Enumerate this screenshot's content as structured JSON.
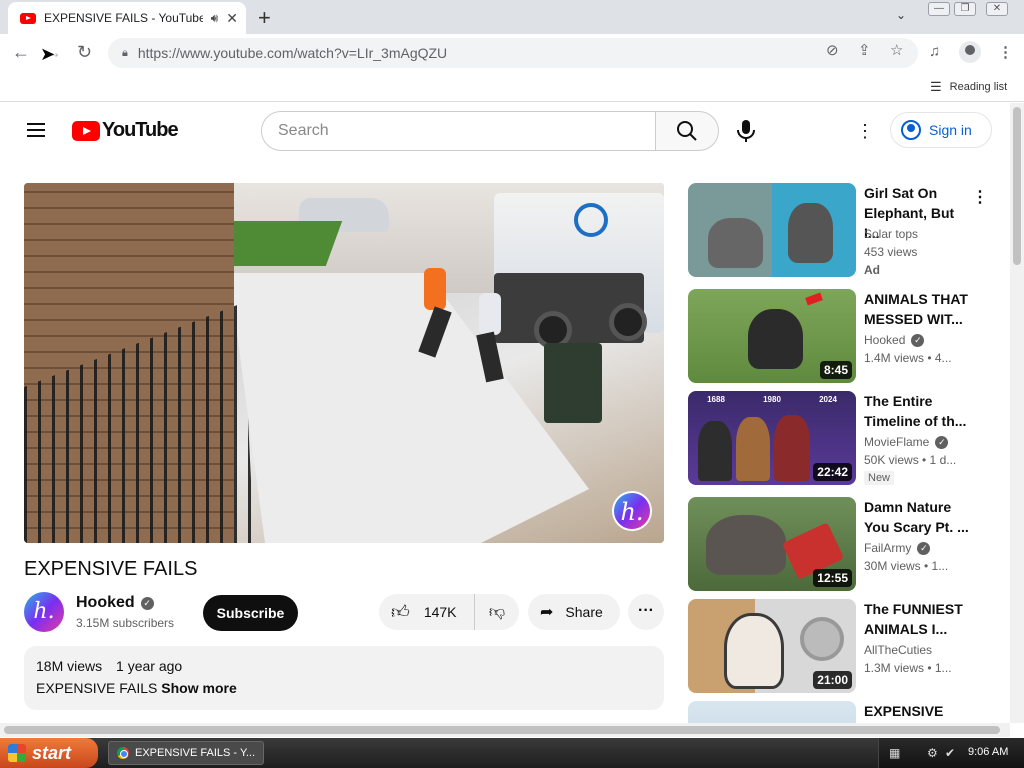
{
  "browser": {
    "tab_title": "EXPENSIVE FAILS - YouTube",
    "url": "https://www.youtube.com/watch?v=LIr_3mAgQZU",
    "reading_list": "Reading list"
  },
  "header": {
    "logo_text": "YouTube",
    "search_placeholder": "Search",
    "sign_in": "Sign in"
  },
  "video": {
    "title": "EXPENSIVE FAILS",
    "channel": "Hooked",
    "subscribers": "3.15M subscribers",
    "subscribe_label": "Subscribe",
    "likes": "147K",
    "share_label": "Share",
    "views": "18M views",
    "age": "1 year ago",
    "description": "EXPENSIVE FAILS",
    "show_more": "Show more",
    "watermark": "h."
  },
  "sidebar": {
    "items": [
      {
        "title": "Girl Sat On Elephant, But I...",
        "channel": "Solar tops",
        "meta": "453 views",
        "badge": "Ad",
        "duration": ""
      },
      {
        "title": "ANIMALS THAT MESSED WIT...",
        "channel": "Hooked",
        "meta": "1.4M views • 4...",
        "badge": "",
        "duration": "8:45"
      },
      {
        "title": "The Entire Timeline of th...",
        "channel": "MovieFlame",
        "meta": "50K views • 1 d...",
        "badge": "New",
        "duration": "22:42"
      },
      {
        "title": "Damn Nature You Scary Pt. ...",
        "channel": "FailArmy",
        "meta": "30M views • 1...",
        "badge": "",
        "duration": "12:55"
      },
      {
        "title": "The FUNNIEST ANIMALS I...",
        "channel": "AllTheCuties",
        "meta": "1.3M views • 1...",
        "badge": "",
        "duration": "21:00"
      },
      {
        "title": "EXPENSIVE",
        "channel": "",
        "meta": "",
        "badge": "",
        "duration": ""
      }
    ],
    "timeline_years": [
      "1688",
      "1980",
      "2024"
    ]
  },
  "taskbar": {
    "start_label": "start",
    "task_item": "EXPENSIVE FAILS - Y...",
    "clock": "9:06 AM"
  },
  "colors": {
    "youtube_red": "#ff0000",
    "link_blue": "#065fd4",
    "xp_start": "#e0612c"
  },
  "icons": [
    "back-icon",
    "forward-icon",
    "reload-icon",
    "lock-icon",
    "eye-off-icon",
    "share-page-icon",
    "star-icon",
    "media-icon",
    "profile-icon",
    "menu-icon",
    "search-icon",
    "mic-icon",
    "kebab-icon",
    "user-icon",
    "thumbs-up-icon",
    "thumbs-down-icon",
    "share-icon",
    "verified-icon"
  ]
}
